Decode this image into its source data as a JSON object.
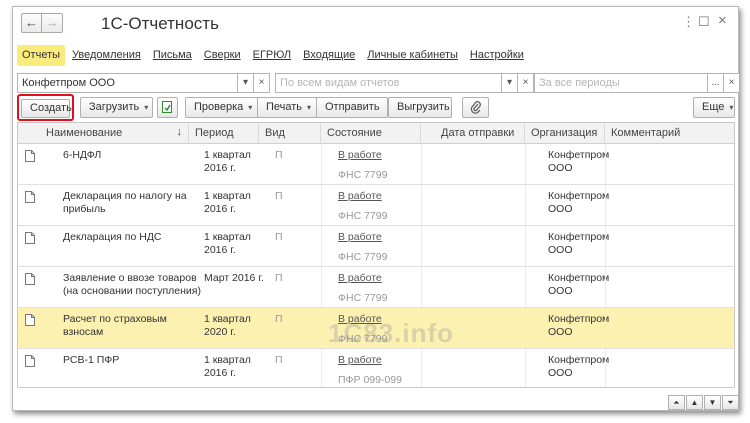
{
  "window": {
    "title": "1С-Отчетность",
    "back_glyph": "←",
    "forward_glyph": "→",
    "more_glyph": "⋮",
    "restore_glyph": "☐",
    "close_glyph": "×"
  },
  "menu": [
    {
      "label": "Отчеты",
      "active": true
    },
    {
      "label": "Уведомления",
      "active": false
    },
    {
      "label": "Письма",
      "active": false
    },
    {
      "label": "Сверки",
      "active": false
    },
    {
      "label": "ЕГРЮЛ",
      "active": false
    },
    {
      "label": "Входящие",
      "active": false
    },
    {
      "label": "Личные кабинеты",
      "active": false
    },
    {
      "label": "Настройки",
      "active": false
    }
  ],
  "filters": {
    "organization": "Конфетпром ООО",
    "report_types_placeholder": "По всем видам отчетов",
    "period_placeholder": "За все периоды",
    "dropdown_glyph": "▾",
    "clear_glyph": "×",
    "select_glyph": "..."
  },
  "toolbar": {
    "create": "Создать",
    "load": "Загрузить",
    "check": "Проверка",
    "print": "Печать",
    "send": "Отправить",
    "unload": "Выгрузить",
    "more": "Еще",
    "caret": "▾"
  },
  "table": {
    "columns": [
      "Наименование",
      "Период",
      "Вид",
      "Состояние",
      "Дата отправки",
      "Организация",
      "Комментарий"
    ],
    "sort_glyph": "↓",
    "rows": [
      {
        "name": [
          "6-НДФЛ"
        ],
        "period": [
          "1 квартал",
          "2016 г."
        ],
        "kind": "П",
        "state": "В работе",
        "recipient": "ФНС 7799",
        "org": [
          "Конфетпром",
          "ООО"
        ],
        "selected": false
      },
      {
        "name": [
          "Декларация по налогу на",
          "прибыль"
        ],
        "period": [
          "1 квартал",
          "2016 г."
        ],
        "kind": "П",
        "state": "В работе",
        "recipient": "ФНС 7799",
        "org": [
          "Конфетпром",
          "ООО"
        ],
        "selected": false
      },
      {
        "name": [
          "Декларация по НДС"
        ],
        "period": [
          "1 квартал",
          "2016 г."
        ],
        "kind": "П",
        "state": "В работе",
        "recipient": "ФНС 7799",
        "org": [
          "Конфетпром",
          "ООО"
        ],
        "selected": false
      },
      {
        "name": [
          "Заявление о ввозе товаров",
          "(на основании поступления)"
        ],
        "period": [
          "Март 2016 г."
        ],
        "kind": "П",
        "state": "В работе",
        "recipient": "ФНС 7799",
        "org": [
          "Конфетпром",
          "ООО"
        ],
        "selected": false
      },
      {
        "name": [
          "Расчет по страховым",
          "взносам"
        ],
        "period": [
          "1 квартал",
          "2020 г."
        ],
        "kind": "П",
        "state": "В работе",
        "recipient": "ФНС 7799",
        "org": [
          "Конфетпром",
          "ООО"
        ],
        "selected": true
      },
      {
        "name": [
          "РСВ-1 ПФР"
        ],
        "period": [
          "1 квартал",
          "2016 г."
        ],
        "kind": "П",
        "state": "В работе",
        "recipient": "ПФР 099-099",
        "org": [
          "Конфетпром",
          "ООО"
        ],
        "selected": false
      }
    ]
  },
  "watermark": "1C83.info",
  "scroll": [
    "⏶",
    "▲",
    "▼",
    "⏷"
  ],
  "colors": {
    "active_menu": "#fbeb7c",
    "selected_row": "#fdf1b2",
    "create_outline": "#e0101a"
  }
}
